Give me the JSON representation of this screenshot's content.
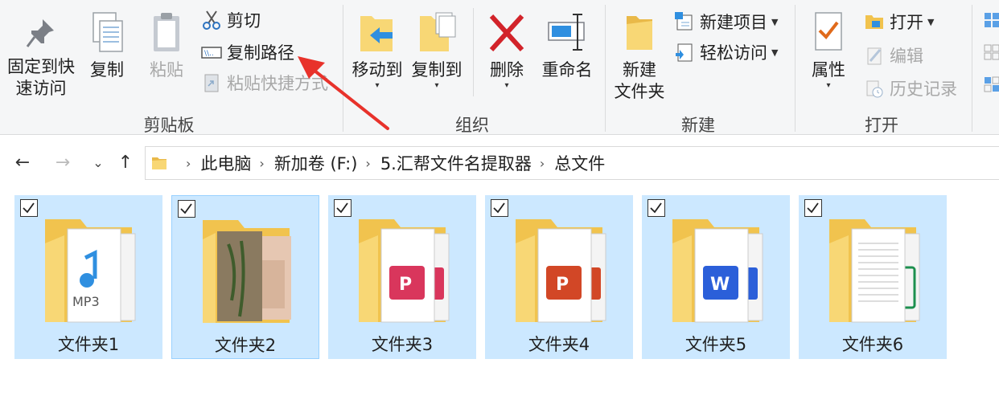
{
  "ribbon": {
    "clipboard": {
      "pin_label_1": "固定到快",
      "pin_label_2": "速访问",
      "copy_label": "复制",
      "paste_label": "粘贴",
      "cut_label": "剪切",
      "copy_path_label": "复制路径",
      "paste_shortcut_label": "粘贴快捷方式",
      "group_label": "剪贴板"
    },
    "organize": {
      "move_to_label": "移动到",
      "copy_to_label": "复制到",
      "delete_label": "删除",
      "rename_label": "重命名",
      "group_label": "组织"
    },
    "new": {
      "new_folder_label_1": "新建",
      "new_folder_label_2": "文件夹",
      "new_item_label": "新建项目",
      "easy_access_label": "轻松访问",
      "group_label": "新建"
    },
    "open": {
      "properties_label": "属性",
      "open_label": "打开",
      "edit_label": "编辑",
      "history_label": "历史记录",
      "group_label": "打开"
    }
  },
  "address": {
    "crumbs": [
      "此电脑",
      "新加卷 (F:)",
      "5.汇帮文件名提取器",
      "总文件"
    ]
  },
  "folders": [
    {
      "name": "文件夹1",
      "content": "mp3"
    },
    {
      "name": "文件夹2",
      "content": "image"
    },
    {
      "name": "文件夹3",
      "content": "wps-ppt"
    },
    {
      "name": "文件夹4",
      "content": "ppt"
    },
    {
      "name": "文件夹5",
      "content": "word"
    },
    {
      "name": "文件夹6",
      "content": "excel"
    }
  ],
  "colors": {
    "selection": "#cce8ff",
    "folder_yellow": "#f8d775",
    "annotation_arrow": "#e8322b",
    "delete_red": "#d2232a"
  }
}
